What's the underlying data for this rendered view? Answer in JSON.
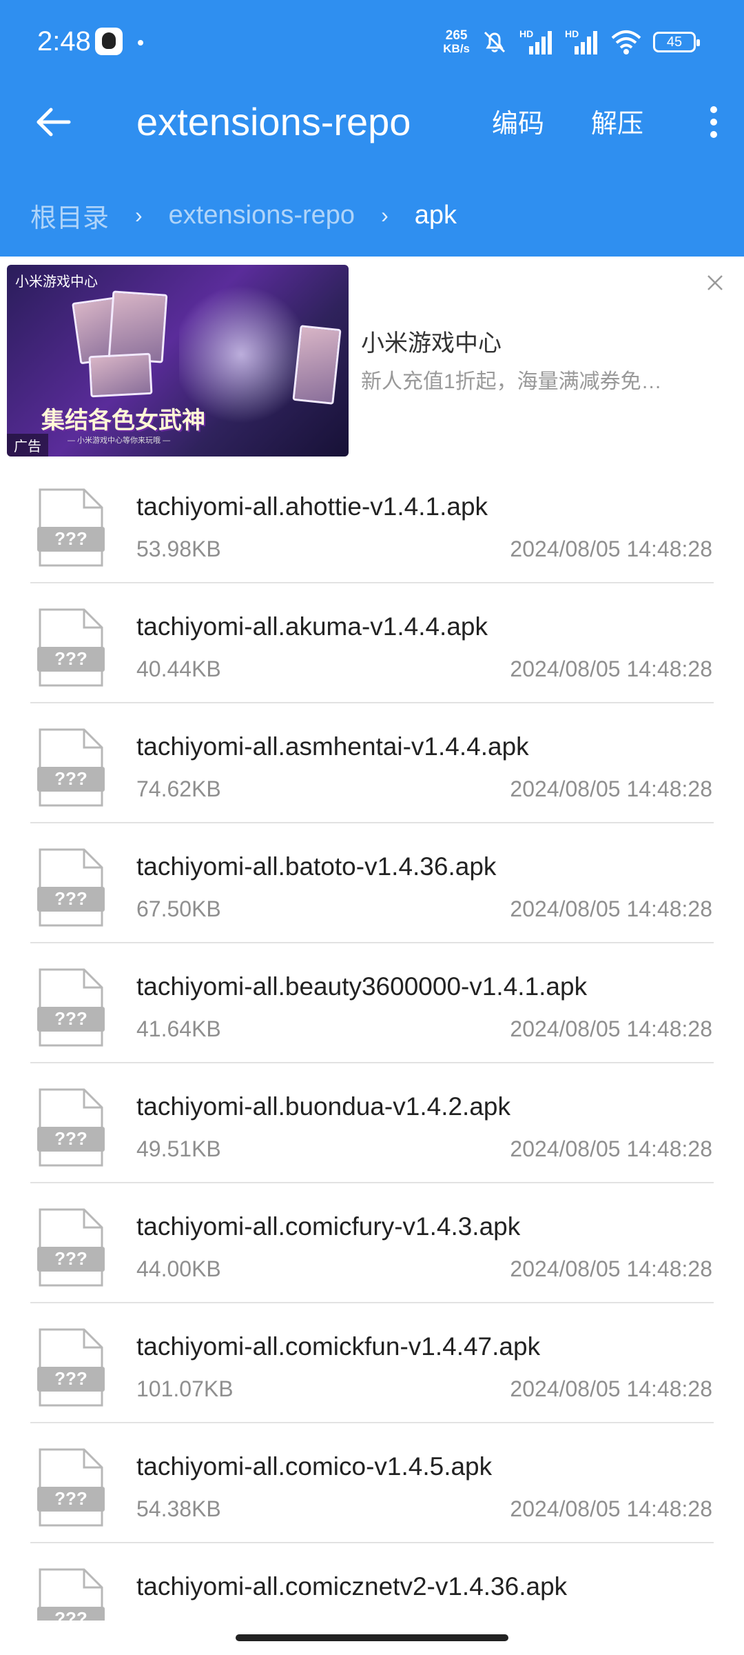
{
  "status_bar": {
    "time": "2:48",
    "net_speed_value": "265",
    "net_speed_unit": "KB/s",
    "signal_label": "HD",
    "battery": "45"
  },
  "toolbar": {
    "title": "extensions-repo",
    "encode_label": "编码",
    "extract_label": "解压"
  },
  "breadcrumb": [
    {
      "label": "根目录"
    },
    {
      "label": "extensions-repo"
    },
    {
      "label": "apk"
    }
  ],
  "ad": {
    "brand": "小米游戏中心",
    "banner_slogan": "集结各色女武神",
    "banner_sub": "— 小米游戏中心等你来玩哦 —",
    "tag": "广告",
    "title": "小米游戏中心",
    "description": "新人充值1折起，海量满减券免…"
  },
  "file_icon_label": "???",
  "files": [
    {
      "name": "tachiyomi-all.ahottie-v1.4.1.apk",
      "size": "53.98KB",
      "date": "2024/08/05 14:48:28"
    },
    {
      "name": "tachiyomi-all.akuma-v1.4.4.apk",
      "size": "40.44KB",
      "date": "2024/08/05 14:48:28"
    },
    {
      "name": "tachiyomi-all.asmhentai-v1.4.4.apk",
      "size": "74.62KB",
      "date": "2024/08/05 14:48:28"
    },
    {
      "name": "tachiyomi-all.batoto-v1.4.36.apk",
      "size": "67.50KB",
      "date": "2024/08/05 14:48:28"
    },
    {
      "name": "tachiyomi-all.beauty3600000-v1.4.1.apk",
      "size": "41.64KB",
      "date": "2024/08/05 14:48:28"
    },
    {
      "name": "tachiyomi-all.buondua-v1.4.2.apk",
      "size": "49.51KB",
      "date": "2024/08/05 14:48:28"
    },
    {
      "name": "tachiyomi-all.comicfury-v1.4.3.apk",
      "size": "44.00KB",
      "date": "2024/08/05 14:48:28"
    },
    {
      "name": "tachiyomi-all.comickfun-v1.4.47.apk",
      "size": "101.07KB",
      "date": "2024/08/05 14:48:28"
    },
    {
      "name": "tachiyomi-all.comico-v1.4.5.apk",
      "size": "54.38KB",
      "date": "2024/08/05 14:48:28"
    },
    {
      "name": "tachiyomi-all.comicznetv2-v1.4.36.apk",
      "size": "",
      "date": ""
    }
  ],
  "colors": {
    "app_bar": "#2f8ff0",
    "list_text": "#222222",
    "meta_text": "#8f8f8f",
    "icon_gray": "#b5b5b5"
  }
}
